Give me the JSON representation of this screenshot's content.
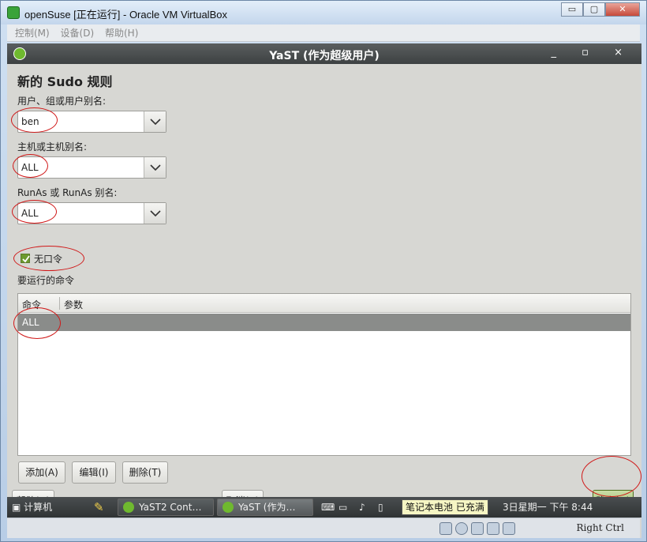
{
  "host_window": {
    "title": "openSuse [正在运行] - Oracle VM VirtualBox",
    "menu": [
      "控制(M)",
      "设备(D)",
      "帮助(H)"
    ],
    "buttons": {
      "minimize": "▭",
      "maximize": "▢",
      "close": "✕"
    }
  },
  "yast": {
    "title": "YaST (作为超级用户)",
    "controls": "_ ▫ ×",
    "heading": "新的 Sudo 规则",
    "user_label": "用户、组或用户别名:",
    "user_value": "ben",
    "host_label": "主机或主机别名:",
    "host_value": "ALL",
    "runas_label": "RunAs 或 RunAs 别名:",
    "runas_value": "ALL",
    "nopasswd_label": "无口令",
    "nopasswd_checked": true,
    "commands_label": "要运行的命令",
    "table": {
      "columns": [
        "命令",
        "参数"
      ],
      "rows": [
        [
          "ALL",
          ""
        ]
      ]
    },
    "buttons": {
      "add": "添加(A)",
      "edit": "编辑(I)",
      "delete": "删除(T)",
      "help": "帮助(H)",
      "cancel": "取消(C)",
      "ok": "确定(O)"
    }
  },
  "taskbar": {
    "computer": "计算机",
    "tasks": [
      "YaST2 Cont…",
      "YaST (作为…"
    ],
    "tooltip": "笔记本电池 已充满",
    "clock": "3日星期一  下午 8:44"
  },
  "statusbar": {
    "host_key": "Right Ctrl"
  },
  "colors": {
    "highlight_ring": "#d01818",
    "selected_row": "#8a8c8a",
    "yast_title_bar": "#3d4142"
  }
}
